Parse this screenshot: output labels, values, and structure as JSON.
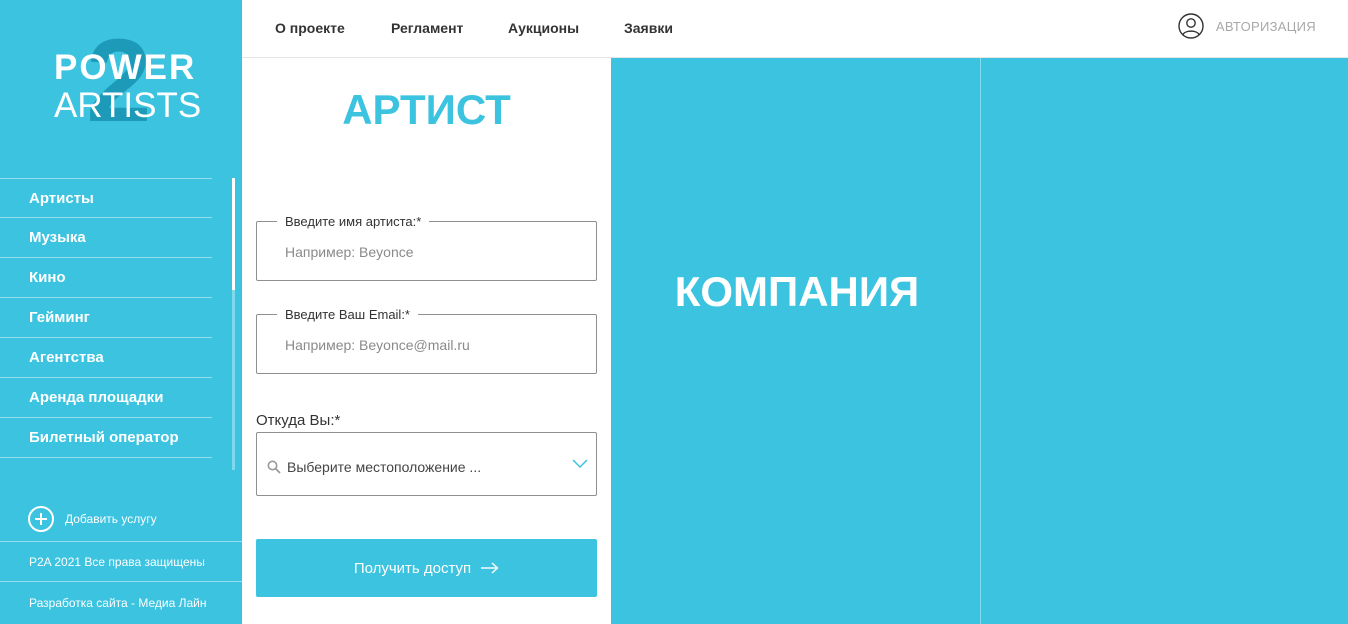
{
  "brand": {
    "logo_numeral": "2",
    "logo_line1": "POWER",
    "logo_line2": "ARTISTS"
  },
  "sidebar": {
    "items": [
      {
        "label": "Артисты"
      },
      {
        "label": "Музыка"
      },
      {
        "label": "Кино"
      },
      {
        "label": "Гейминг"
      },
      {
        "label": "Агентства"
      },
      {
        "label": "Аренда площадки"
      },
      {
        "label": "Билетный оператор"
      }
    ],
    "add_service_label": "Добавить услугу",
    "copyright": "P2A 2021 Все права защищены",
    "developer": "Разработка сайта - Медиа Лайн"
  },
  "topnav": {
    "links": [
      {
        "label": "О проекте"
      },
      {
        "label": "Регламент"
      },
      {
        "label": "Аукционы"
      },
      {
        "label": "Заявки"
      }
    ],
    "auth_label": "АВТОРИЗАЦИЯ",
    "auth_icon": "user-circle-icon"
  },
  "artist_form": {
    "title": "АРТИСТ",
    "name_field": {
      "legend": "Введите имя артиста:*",
      "placeholder": "Например: Beyonce",
      "value": ""
    },
    "email_field": {
      "legend": "Введите Ваш Email:*",
      "placeholder": "Например: Beyonce@mail.ru",
      "value": ""
    },
    "location_label": "Откуда Вы:*",
    "location_select": {
      "placeholder": "Выберите местоположение ...",
      "icon": "search-icon"
    },
    "submit_label": "Получить доступ",
    "submit_icon": "arrow-right-icon"
  },
  "company_panel": {
    "title": "КОМПАНИЯ"
  },
  "colors": {
    "accent": "#3cc3e0",
    "logo_numeral": "#1e9ab9",
    "text_dark": "#333333",
    "muted": "#a8a8a8"
  }
}
